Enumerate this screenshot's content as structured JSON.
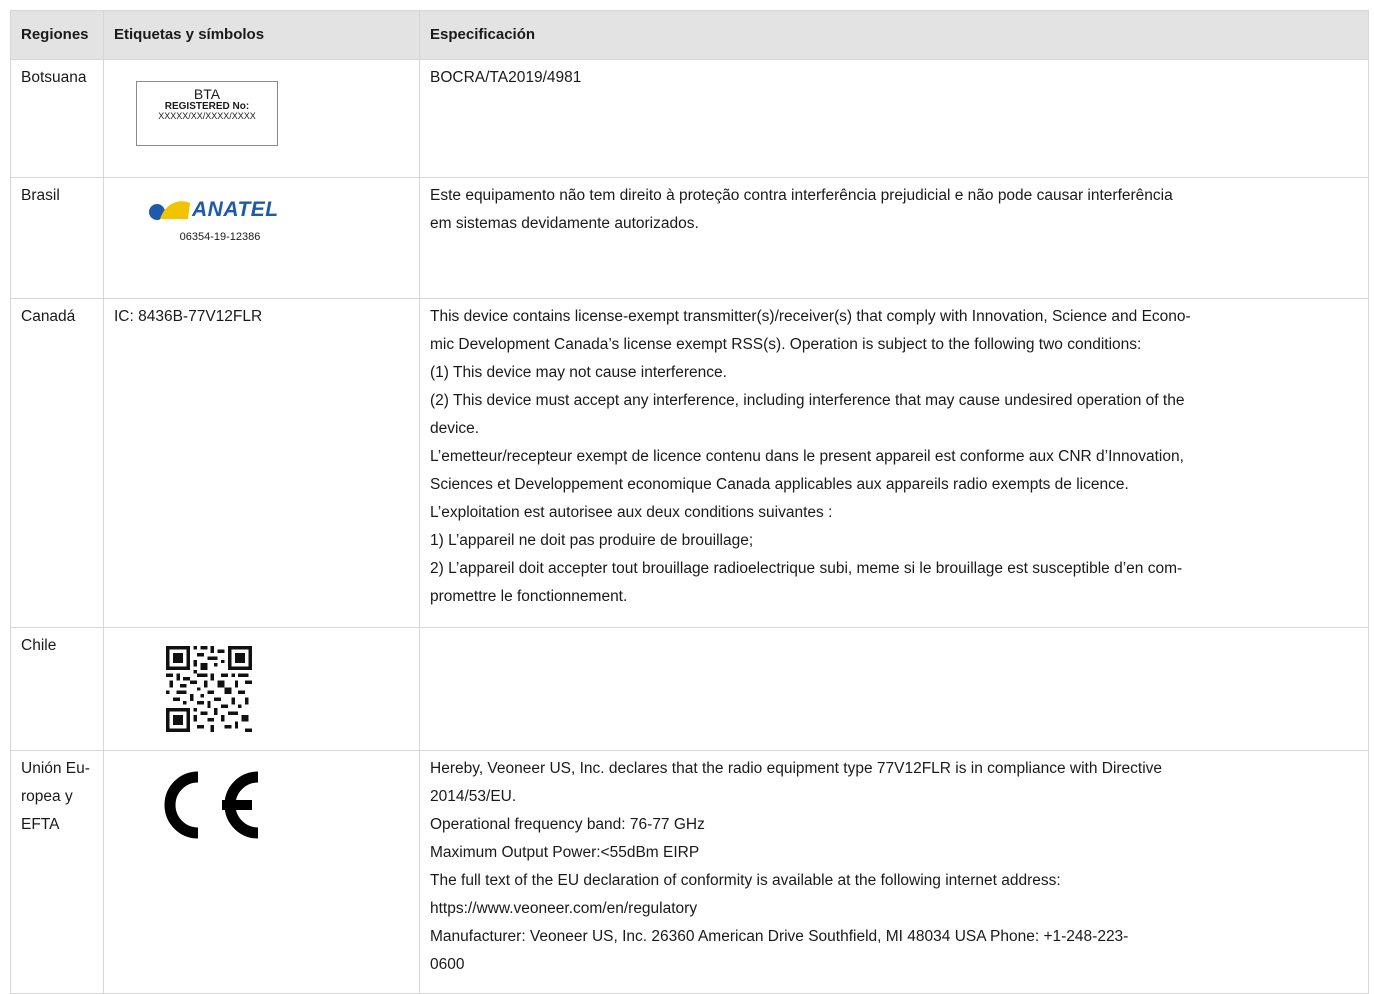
{
  "header": {
    "col1": "Regiones",
    "col2": "Etiquetas y símbolos",
    "col3": "Especificación"
  },
  "rows": {
    "botsuana": {
      "region": "Botsuana",
      "label": {
        "line1": "BTA",
        "line2": "REGISTERED No:",
        "line3": "XXXXX/XX/XXXX/XXXX"
      },
      "spec": "BOCRA/TA2019/4981"
    },
    "brasil": {
      "region": "Brasil",
      "label": {
        "brand": "ANATEL",
        "number": "06354-19-12386",
        "colors": {
          "blue": "#1e5aa8",
          "yellow": "#f2c400"
        }
      },
      "spec": [
        "Este equipamento não tem direito à proteção contra interferência prejudicial e não pode causar interferência",
        "em sistemas devidamente autorizados."
      ]
    },
    "canada": {
      "region": "Canadá",
      "label": "IC: 8436B-77V12FLR",
      "spec": [
        "This device contains license-exempt transmitter(s)/receiver(s) that comply with Innovation, Science and Econo-",
        "mic Development Canada’s license exempt RSS(s). Operation is subject to the following two conditions:",
        "(1) This device may not cause interference.",
        "(2) This device must accept any interference, including interference that may cause undesired operation of the",
        "device.",
        "L’emetteur/recepteur exempt de licence contenu dans le present appareil est conforme aux CNR d’Innovation,",
        "Sciences et Developpement economique Canada applicables aux appareils radio exempts de licence.",
        "L’exploitation est autorisee aux deux conditions suivantes :",
        "1) L’appareil ne doit pas produire de brouillage;",
        "2) L’appareil doit accepter tout brouillage radioelectrique subi, meme si le brouillage est susceptible d’en com-",
        "promettre le fonctionnement."
      ]
    },
    "chile": {
      "region": "Chile",
      "label": "qr-code",
      "spec": ""
    },
    "eu": {
      "region_lines": [
        "Unión Eu-",
        "ropea y",
        "EFTA"
      ],
      "label": "ce-mark",
      "spec": [
        "Hereby, Veoneer US, Inc. declares that the radio equipment type 77V12FLR is in compliance with Directive",
        "2014/53/EU.",
        "Operational frequency band: 76-77 GHz",
        "Maximum Output Power:<55dBm EIRP",
        "The full text of the EU declaration of conformity is available at the following internet address:",
        "https://www.veoneer.com/en/regulatory",
        "Manufacturer: Veoneer US, Inc. 26360 American Drive Southfield, MI 48034 USA Phone: +1-248-223-",
        "0600"
      ]
    }
  },
  "colors": {
    "header_bg": "#e3e3e3",
    "border": "#d6d6d6"
  }
}
